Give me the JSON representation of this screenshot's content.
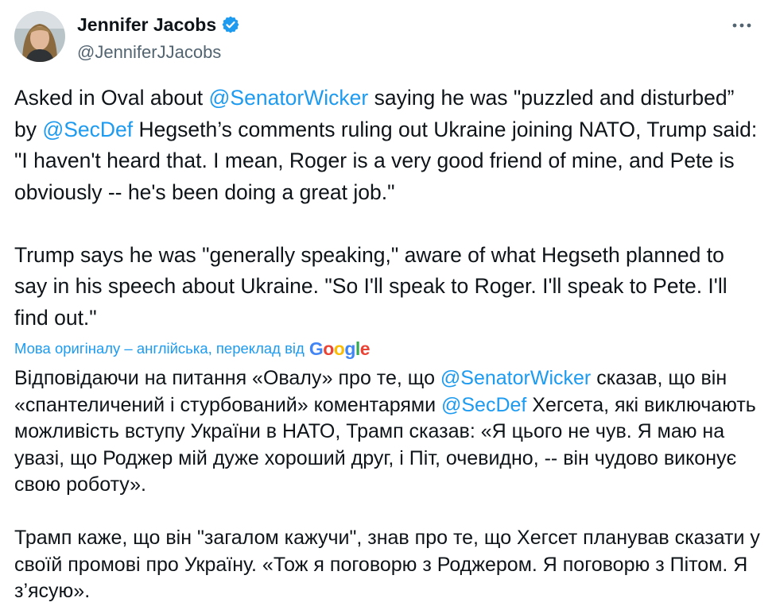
{
  "author": {
    "display_name": "Jennifer Jacobs",
    "handle": "@JenniferJJacobs",
    "verified_icon": "verified-badge-icon",
    "avatar_icon": "avatar-photo"
  },
  "more_icon": "more-options-icon",
  "tweet": {
    "p1": {
      "t1": "Asked in Oval about ",
      "m1": "@SenatorWicker",
      "t2": " saying he was \"puzzled and disturbed” by ",
      "m2": "@SecDef",
      "t3": " Hegseth’s comments ruling out Ukraine joining NATO, Trump said: \"I haven't heard that. I mean, Roger is a very good friend of mine, and Pete is obviously -- he's been doing a great job.\""
    },
    "p2": "Trump says he was \"generally speaking,\" aware of what Hegseth planned to say in his speech about Ukraine. \"So I'll speak to Roger. I'll speak to Pete. I'll find out.\""
  },
  "translation": {
    "label": "Мова оригіналу – англійська, переклад від",
    "provider": "Google",
    "p1": {
      "t1": "Відповідаючи на питання «Овалу» про те, що ",
      "m1": "@SenatorWicker",
      "t2": " сказав, що він «спантеличений і стурбований» коментарями ",
      "m2": "@SecDef",
      "t3": " Хегсета, які виключають можливість вступу України в НАТО, Трамп сказав: «Я цього не чув. Я маю на увазі, що Роджер мій дуже хороший друг, і Піт, очевидно, -- він чудово виконує свою роботу»."
    },
    "p2": "Трамп каже, що він \"загалом кажучи\", знав про те, що Хегсет планував сказати у своїй промові про Україну. «Тож я поговорю з Роджером. Я поговорю з Пітом. Я з’ясую»."
  },
  "colors": {
    "link": "#1d9bf0",
    "text": "#0f1419",
    "secondary": "#536471",
    "google_blue": "#4285F4",
    "google_red": "#EA4335",
    "google_yellow": "#FBBC05",
    "google_green": "#34A853"
  }
}
